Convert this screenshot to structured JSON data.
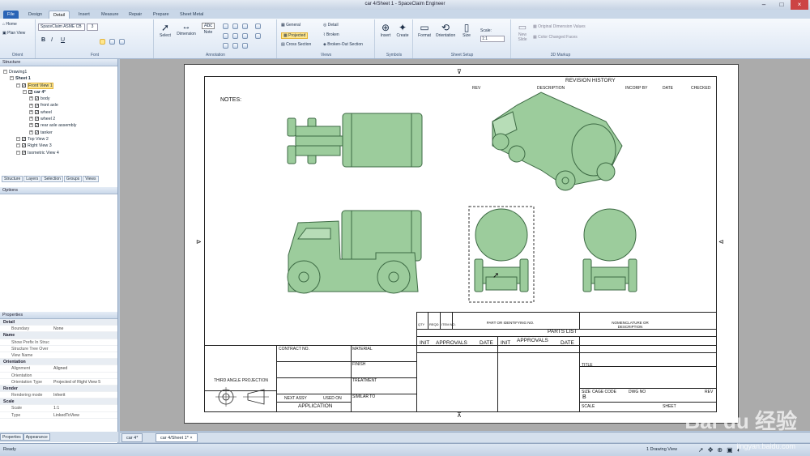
{
  "window": {
    "title": "car 4/Sheet 1 - SpaceClaim Engineer"
  },
  "tabs": [
    {
      "label": "File"
    },
    {
      "label": "Design"
    },
    {
      "label": "Detail"
    },
    {
      "label": "Insert"
    },
    {
      "label": "Measure"
    },
    {
      "label": "Repair"
    },
    {
      "label": "Prepare"
    },
    {
      "label": "Sheet Metal"
    }
  ],
  "ribbon": {
    "orient": {
      "home": "Home",
      "plan_view": "Plan View",
      "label": "Orient"
    },
    "font": {
      "name": "SpaceClaim ASME CB",
      "size": "3",
      "bold": "B",
      "italic": "I",
      "underline": "U",
      "label": "Font"
    },
    "annotation": {
      "select": "Select",
      "dimension": "Dimension",
      "note": "Note",
      "abc": "Abc",
      "label": "Annotation"
    },
    "views": {
      "general": "General",
      "projected": "Projected",
      "cross_section": "Cross Section",
      "detail": "Detail",
      "broken": "Broken",
      "broken_out": "Broken-Out Section",
      "label": "Views"
    },
    "symbols": {
      "insert": "Insert",
      "create": "Create",
      "label": "Symbols"
    },
    "sheet_setup": {
      "format": "Format",
      "orientation": "Orientation",
      "size": "Size",
      "scale_label": "Scale:",
      "scale_value": "1:1",
      "label": "Sheet Setup"
    },
    "markup": {
      "new_slide": "New Slide",
      "original_dims": "Original Dimension Values",
      "color_changed": "Color Changed Faces",
      "label": "3D Markup"
    }
  },
  "structure": {
    "header": "Structure",
    "tree": [
      {
        "label": "Drawing1",
        "level": 0
      },
      {
        "label": "Sheet 1",
        "level": 1
      },
      {
        "label": "Front View 1",
        "level": 2,
        "selected": true
      },
      {
        "label": "car 4*",
        "level": 3
      },
      {
        "label": "body",
        "level": 4
      },
      {
        "label": "front axle",
        "level": 4
      },
      {
        "label": "wheel",
        "level": 4
      },
      {
        "label": "wheel 2",
        "level": 4
      },
      {
        "label": "rear axle assembly",
        "level": 4
      },
      {
        "label": "tanker",
        "level": 4
      },
      {
        "label": "Top View 2",
        "level": 2
      },
      {
        "label": "Right View 3",
        "level": 2
      },
      {
        "label": "Isometric View 4",
        "level": 2
      }
    ],
    "panel_tabs": [
      "Structure",
      "Layers",
      "Selection",
      "Groups",
      "Views"
    ]
  },
  "options": {
    "header": "Options"
  },
  "properties": {
    "header": "Properties",
    "rows": [
      {
        "cat": "Detail"
      },
      {
        "k": "Boundary",
        "v": "None"
      },
      {
        "cat": "Name"
      },
      {
        "k": "Show Prefix In Struc",
        "v": ""
      },
      {
        "k": "Structure Tree Over",
        "v": ""
      },
      {
        "k": "View Name",
        "v": ""
      },
      {
        "cat": "Orientation"
      },
      {
        "k": "Alignment",
        "v": "Aligned"
      },
      {
        "k": "Orientation",
        "v": ""
      },
      {
        "k": "Orientation Type",
        "v": "Projected of Right View 5"
      },
      {
        "cat": "Render"
      },
      {
        "k": "Rendering mode",
        "v": "Inherit"
      },
      {
        "cat": "Scale"
      },
      {
        "k": "Scale",
        "v": "1:1"
      },
      {
        "k": "Type",
        "v": "LinkedToView"
      }
    ],
    "bottom_tabs": [
      "Properties",
      "Appearance"
    ]
  },
  "sheet": {
    "notes": "NOTES:",
    "revision_history": "REVISION HISTORY",
    "rev": "REV",
    "description": "DESCRIPTION",
    "incorp_by": "INCORP BY",
    "date": "DATE",
    "checked": "CHECKED",
    "qty": "QTY",
    "reqd": "REQD",
    "item_no": "ITEM NO.",
    "part_or_id": "PART OR IDENTIFYING NO.",
    "nomenclature": "NOMENCLATURE OR DESCRIPTION",
    "parts_list": "PARTS LIST",
    "contract_no": "CONTRACT NO.",
    "material": "MATERIAL",
    "finish": "FINISH",
    "treatment": "TREATMENT",
    "similar_to": "SIMILAR TO",
    "init": "INIT",
    "approvals": "APPROVALS",
    "title": "TITLE",
    "third_angle": "THIRD ANGLE PROJECTION",
    "next_assy": "NEXT ASSY",
    "used_on": "USED ON",
    "application": "APPLICATION",
    "size": "SIZE",
    "size_value": "B",
    "cage_code": "CAGE CODE",
    "scale": "SCALE",
    "sheet": "SHEET",
    "drawing_no": "DWG NO",
    "rev_block": "REV"
  },
  "doc_tabs": [
    "car 4*",
    "car 4/Sheet 1*"
  ],
  "status": {
    "ready": "Ready",
    "drawing_views": "1 Drawing View"
  },
  "watermark": {
    "brand": "Bai du 经验",
    "url": "jingyan.baidu.com"
  },
  "colors": {
    "part_fill": "#9ccc9c",
    "part_stroke": "#3d6a44",
    "ribbon_accent": "#2a64b6"
  }
}
